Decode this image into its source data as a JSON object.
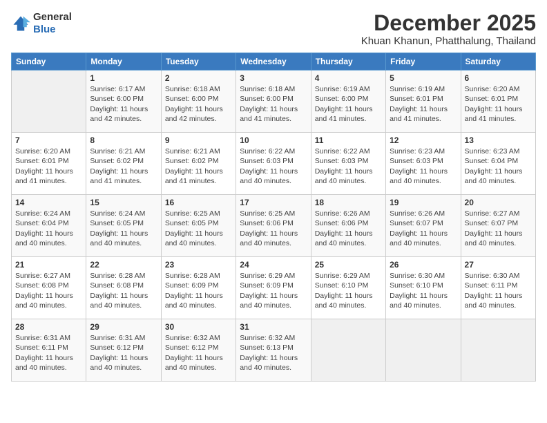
{
  "logo": {
    "general": "General",
    "blue": "Blue"
  },
  "header": {
    "month_year": "December 2025",
    "location": "Khuan Khanun, Phatthalung, Thailand"
  },
  "weekdays": [
    "Sunday",
    "Monday",
    "Tuesday",
    "Wednesday",
    "Thursday",
    "Friday",
    "Saturday"
  ],
  "weeks": [
    [
      {
        "day": "",
        "sunrise": "",
        "sunset": "",
        "daylight": ""
      },
      {
        "day": "1",
        "sunrise": "Sunrise: 6:17 AM",
        "sunset": "Sunset: 6:00 PM",
        "daylight": "Daylight: 11 hours and 42 minutes."
      },
      {
        "day": "2",
        "sunrise": "Sunrise: 6:18 AM",
        "sunset": "Sunset: 6:00 PM",
        "daylight": "Daylight: 11 hours and 42 minutes."
      },
      {
        "day": "3",
        "sunrise": "Sunrise: 6:18 AM",
        "sunset": "Sunset: 6:00 PM",
        "daylight": "Daylight: 11 hours and 41 minutes."
      },
      {
        "day": "4",
        "sunrise": "Sunrise: 6:19 AM",
        "sunset": "Sunset: 6:00 PM",
        "daylight": "Daylight: 11 hours and 41 minutes."
      },
      {
        "day": "5",
        "sunrise": "Sunrise: 6:19 AM",
        "sunset": "Sunset: 6:01 PM",
        "daylight": "Daylight: 11 hours and 41 minutes."
      },
      {
        "day": "6",
        "sunrise": "Sunrise: 6:20 AM",
        "sunset": "Sunset: 6:01 PM",
        "daylight": "Daylight: 11 hours and 41 minutes."
      }
    ],
    [
      {
        "day": "7",
        "sunrise": "Sunrise: 6:20 AM",
        "sunset": "Sunset: 6:01 PM",
        "daylight": "Daylight: 11 hours and 41 minutes."
      },
      {
        "day": "8",
        "sunrise": "Sunrise: 6:21 AM",
        "sunset": "Sunset: 6:02 PM",
        "daylight": "Daylight: 11 hours and 41 minutes."
      },
      {
        "day": "9",
        "sunrise": "Sunrise: 6:21 AM",
        "sunset": "Sunset: 6:02 PM",
        "daylight": "Daylight: 11 hours and 41 minutes."
      },
      {
        "day": "10",
        "sunrise": "Sunrise: 6:22 AM",
        "sunset": "Sunset: 6:03 PM",
        "daylight": "Daylight: 11 hours and 40 minutes."
      },
      {
        "day": "11",
        "sunrise": "Sunrise: 6:22 AM",
        "sunset": "Sunset: 6:03 PM",
        "daylight": "Daylight: 11 hours and 40 minutes."
      },
      {
        "day": "12",
        "sunrise": "Sunrise: 6:23 AM",
        "sunset": "Sunset: 6:03 PM",
        "daylight": "Daylight: 11 hours and 40 minutes."
      },
      {
        "day": "13",
        "sunrise": "Sunrise: 6:23 AM",
        "sunset": "Sunset: 6:04 PM",
        "daylight": "Daylight: 11 hours and 40 minutes."
      }
    ],
    [
      {
        "day": "14",
        "sunrise": "Sunrise: 6:24 AM",
        "sunset": "Sunset: 6:04 PM",
        "daylight": "Daylight: 11 hours and 40 minutes."
      },
      {
        "day": "15",
        "sunrise": "Sunrise: 6:24 AM",
        "sunset": "Sunset: 6:05 PM",
        "daylight": "Daylight: 11 hours and 40 minutes."
      },
      {
        "day": "16",
        "sunrise": "Sunrise: 6:25 AM",
        "sunset": "Sunset: 6:05 PM",
        "daylight": "Daylight: 11 hours and 40 minutes."
      },
      {
        "day": "17",
        "sunrise": "Sunrise: 6:25 AM",
        "sunset": "Sunset: 6:06 PM",
        "daylight": "Daylight: 11 hours and 40 minutes."
      },
      {
        "day": "18",
        "sunrise": "Sunrise: 6:26 AM",
        "sunset": "Sunset: 6:06 PM",
        "daylight": "Daylight: 11 hours and 40 minutes."
      },
      {
        "day": "19",
        "sunrise": "Sunrise: 6:26 AM",
        "sunset": "Sunset: 6:07 PM",
        "daylight": "Daylight: 11 hours and 40 minutes."
      },
      {
        "day": "20",
        "sunrise": "Sunrise: 6:27 AM",
        "sunset": "Sunset: 6:07 PM",
        "daylight": "Daylight: 11 hours and 40 minutes."
      }
    ],
    [
      {
        "day": "21",
        "sunrise": "Sunrise: 6:27 AM",
        "sunset": "Sunset: 6:08 PM",
        "daylight": "Daylight: 11 hours and 40 minutes."
      },
      {
        "day": "22",
        "sunrise": "Sunrise: 6:28 AM",
        "sunset": "Sunset: 6:08 PM",
        "daylight": "Daylight: 11 hours and 40 minutes."
      },
      {
        "day": "23",
        "sunrise": "Sunrise: 6:28 AM",
        "sunset": "Sunset: 6:09 PM",
        "daylight": "Daylight: 11 hours and 40 minutes."
      },
      {
        "day": "24",
        "sunrise": "Sunrise: 6:29 AM",
        "sunset": "Sunset: 6:09 PM",
        "daylight": "Daylight: 11 hours and 40 minutes."
      },
      {
        "day": "25",
        "sunrise": "Sunrise: 6:29 AM",
        "sunset": "Sunset: 6:10 PM",
        "daylight": "Daylight: 11 hours and 40 minutes."
      },
      {
        "day": "26",
        "sunrise": "Sunrise: 6:30 AM",
        "sunset": "Sunset: 6:10 PM",
        "daylight": "Daylight: 11 hours and 40 minutes."
      },
      {
        "day": "27",
        "sunrise": "Sunrise: 6:30 AM",
        "sunset": "Sunset: 6:11 PM",
        "daylight": "Daylight: 11 hours and 40 minutes."
      }
    ],
    [
      {
        "day": "28",
        "sunrise": "Sunrise: 6:31 AM",
        "sunset": "Sunset: 6:11 PM",
        "daylight": "Daylight: 11 hours and 40 minutes."
      },
      {
        "day": "29",
        "sunrise": "Sunrise: 6:31 AM",
        "sunset": "Sunset: 6:12 PM",
        "daylight": "Daylight: 11 hours and 40 minutes."
      },
      {
        "day": "30",
        "sunrise": "Sunrise: 6:32 AM",
        "sunset": "Sunset: 6:12 PM",
        "daylight": "Daylight: 11 hours and 40 minutes."
      },
      {
        "day": "31",
        "sunrise": "Sunrise: 6:32 AM",
        "sunset": "Sunset: 6:13 PM",
        "daylight": "Daylight: 11 hours and 40 minutes."
      },
      {
        "day": "",
        "sunrise": "",
        "sunset": "",
        "daylight": ""
      },
      {
        "day": "",
        "sunrise": "",
        "sunset": "",
        "daylight": ""
      },
      {
        "day": "",
        "sunrise": "",
        "sunset": "",
        "daylight": ""
      }
    ]
  ]
}
